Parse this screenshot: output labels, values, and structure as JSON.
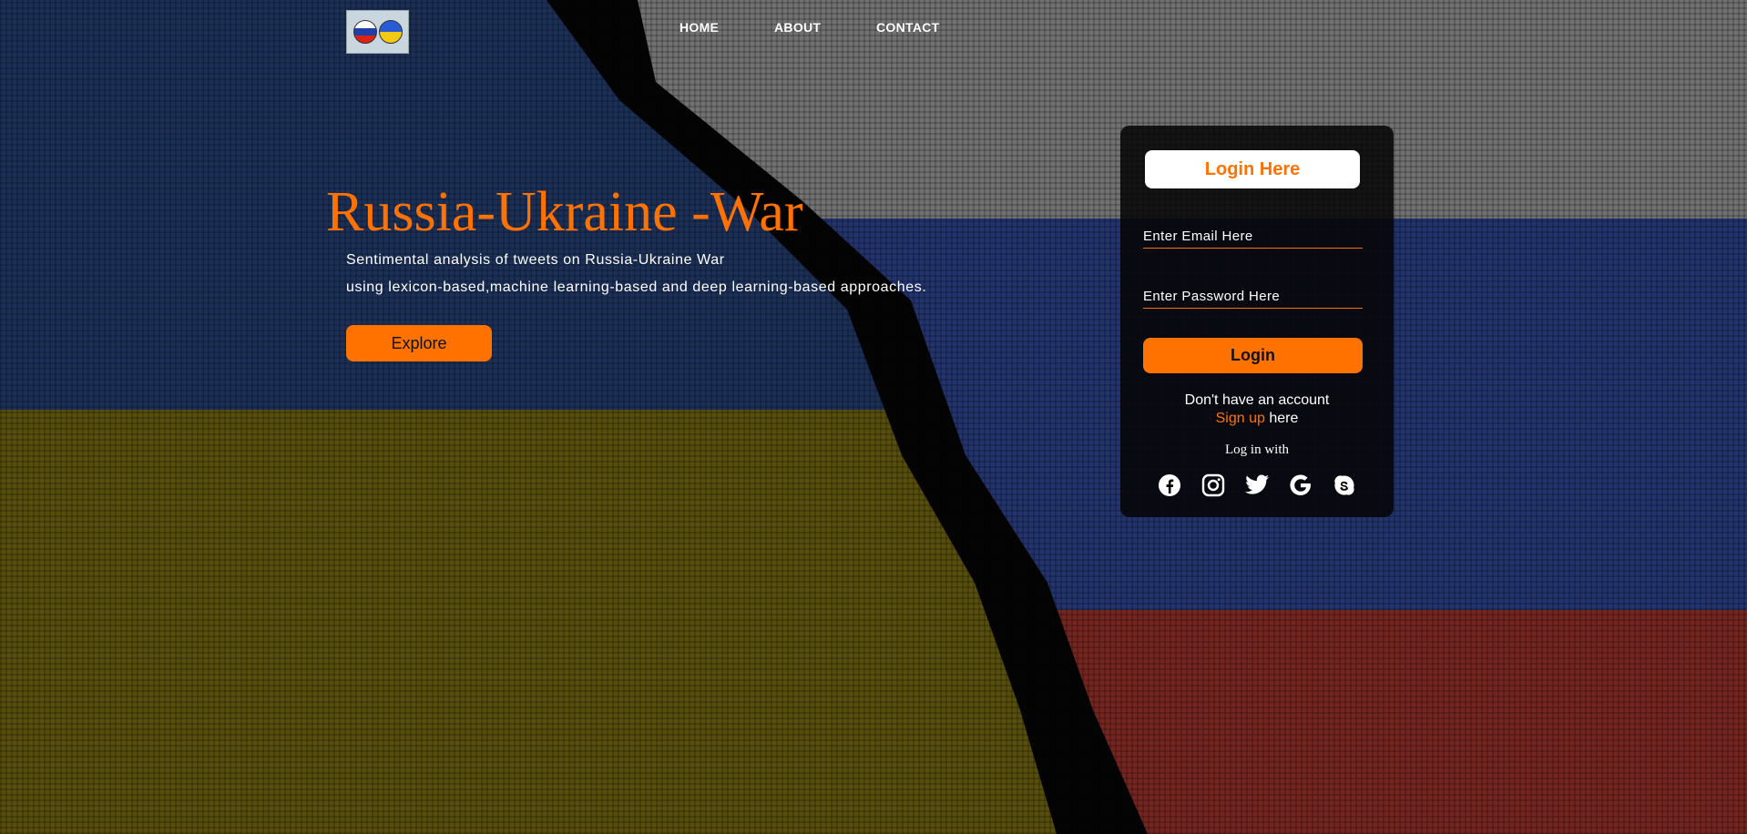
{
  "nav": {
    "logo_alt": "Russia Ukraine logo",
    "items": [
      {
        "label": "HOME"
      },
      {
        "label": "ABOUT"
      },
      {
        "label": "CONTACT"
      }
    ]
  },
  "hero": {
    "title": "Russia-Ukraine -War",
    "line1": "Sentimental analysis of tweets on Russia-Ukraine War",
    "line2": "using lexicon-based,machine learning-based and deep learning-based approaches.",
    "explore_label": "Explore"
  },
  "login": {
    "title": "Login Here",
    "email_placeholder": "Enter Email Here",
    "password_placeholder": "Enter Password Here",
    "button_label": "Login",
    "no_account_text": "Don't have an account",
    "signup_link": "Sign up",
    "signup_suffix": " here",
    "login_with": "Log in with",
    "socials": [
      "facebook-icon",
      "instagram-icon",
      "twitter-icon",
      "google-icon",
      "skype-icon"
    ]
  },
  "colors": {
    "accent": "#ff7200",
    "panel_bg": "#050505"
  }
}
